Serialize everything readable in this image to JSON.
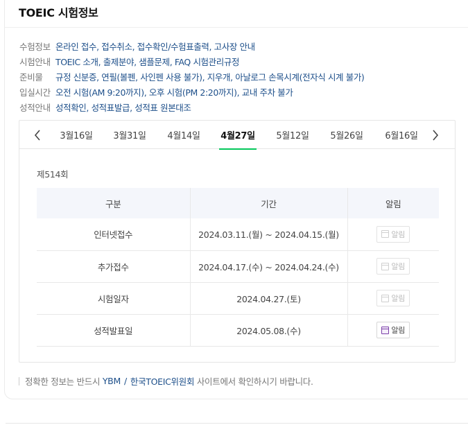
{
  "card": {
    "title": "TOEIC 시험정보"
  },
  "info": [
    {
      "label": "수험정보",
      "links": [
        "온라인 접수",
        "접수취소",
        "접수확인/수험표출력",
        "고사장 안내"
      ]
    },
    {
      "label": "시험안내",
      "links": [
        "TOEIC 소개",
        "출제분야",
        "샘플문제",
        "FAQ",
        "시험관리규정"
      ]
    },
    {
      "label": "준비물",
      "links": [
        "규정 신분증",
        "연필(볼펜, 사인펜 사용 불가)",
        "지우개",
        "아날로그 손목시계(전자식 시계 불가)"
      ]
    },
    {
      "label": "입실시간",
      "links": [
        "오전 시험(AM 9:20까지)",
        "오후 시험(PM 2:20까지)",
        "교내 주차 불가"
      ]
    },
    {
      "label": "성적안내",
      "links": [
        "성적확인",
        "성적표발급",
        "성적표 원본대조"
      ]
    }
  ],
  "schedule": {
    "tabs": [
      "3월16일",
      "3월31일",
      "4월14일",
      "4월27일",
      "5월12일",
      "5월26일",
      "6월16일"
    ],
    "active_tab": "4월27일",
    "round": "제514회",
    "headers": {
      "category": "구분",
      "period": "기간",
      "alarm": "알림"
    },
    "rows": [
      {
        "category": "인터넷접수",
        "period": "2024.03.11.(월) ~ 2024.04.15.(월)",
        "alarm": "알림",
        "alarm_enabled": false
      },
      {
        "category": "추가접수",
        "period": "2024.04.17.(수) ~ 2024.04.24.(수)",
        "alarm": "알림",
        "alarm_enabled": false
      },
      {
        "category": "시험일자",
        "period": "2024.04.27.(토)",
        "alarm": "알림",
        "alarm_enabled": false
      },
      {
        "category": "성적발표일",
        "period": "2024.05.08.(수)",
        "alarm": "알림",
        "alarm_enabled": true
      }
    ]
  },
  "notice": {
    "prefix": "정확한 정보는 반드시",
    "link1": "YBM",
    "slash": "/",
    "link2": "한국TOEIC위원회",
    "suffix": "사이트에서 확인하시기 바랍니다."
  },
  "icons": {
    "prev": "chevron-left-icon",
    "next": "chevron-right-icon",
    "calendar": "calendar-icon"
  },
  "colors": {
    "accent": "#03c75a",
    "link": "#1d4f8a",
    "alarm_on": "#7a3ea8"
  }
}
